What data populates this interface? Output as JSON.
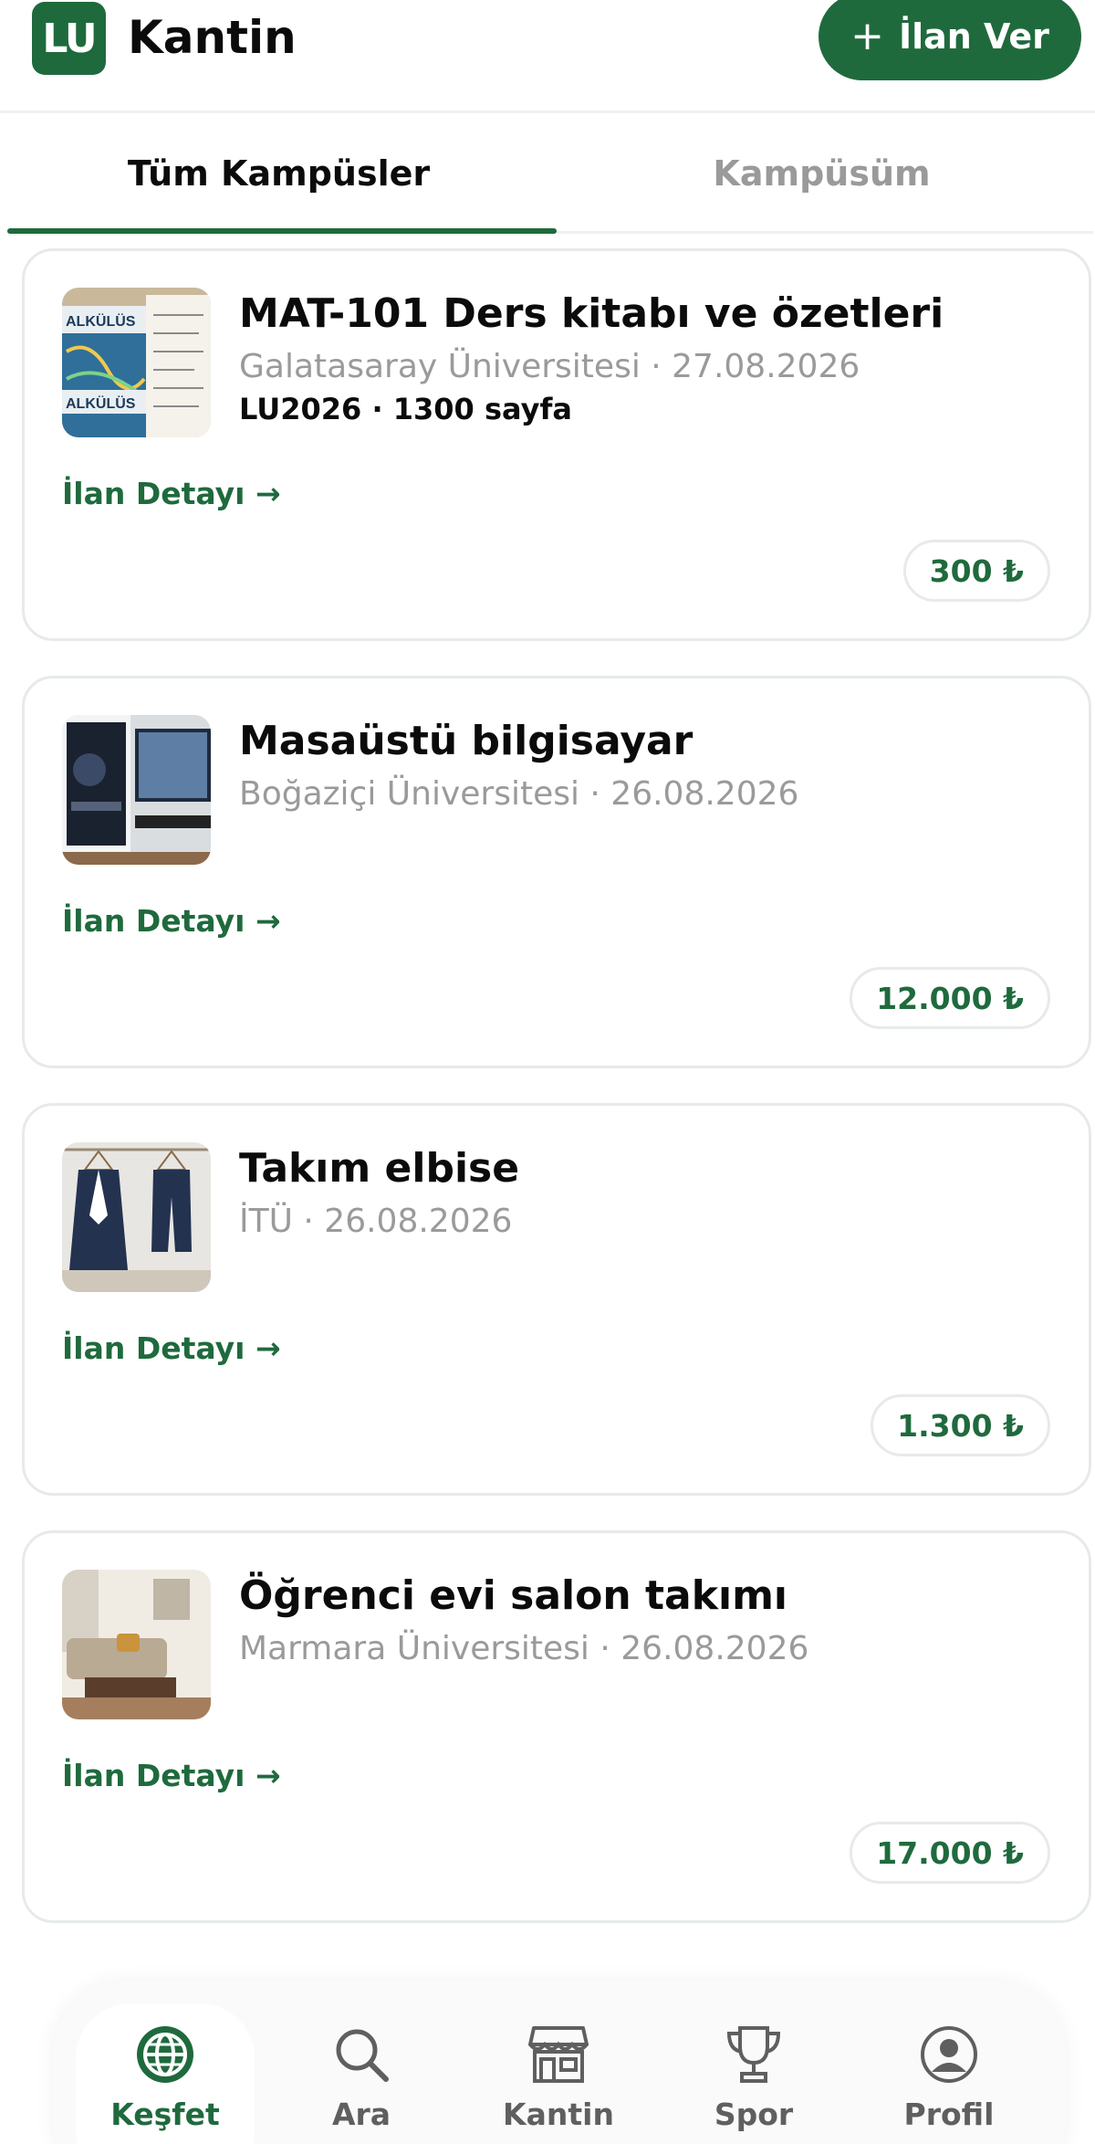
{
  "header": {
    "logo_text": "LU",
    "title": "Kantin",
    "post_button_label": "İlan Ver"
  },
  "tabs": [
    {
      "label": "Tüm Kampüsler",
      "active": true
    },
    {
      "label": "Kampüsüm",
      "active": false
    }
  ],
  "listings": [
    {
      "title": "MAT-101 Ders kitabı ve özetleri",
      "meta": "Galatasaray Üniversitesi · 27.08.2026",
      "extra": "LU2026 · 1300 sayfa",
      "detail_label": "İlan Detayı →",
      "price": "300 ₺",
      "thumb_icon": "book-photo"
    },
    {
      "title": "Masaüstü bilgisayar",
      "meta": "Boğaziçi Üniversitesi · 26.08.2026",
      "extra": "",
      "detail_label": "İlan Detayı →",
      "price": "12.000 ₺",
      "thumb_icon": "computer-photo"
    },
    {
      "title": "Takım elbise",
      "meta": "İTÜ · 26.08.2026",
      "extra": "",
      "detail_label": "İlan Detayı →",
      "price": "1.300 ₺",
      "thumb_icon": "suit-photo"
    },
    {
      "title": "Öğrenci evi salon takımı",
      "meta": "Marmara Üniversitesi · 26.08.2026",
      "extra": "",
      "detail_label": "İlan Detayı →",
      "price": "17.000 ₺",
      "thumb_icon": "living-room-photo"
    }
  ],
  "bottom_nav": [
    {
      "label": "Keşfet",
      "icon": "globe-icon",
      "active": true
    },
    {
      "label": "Ara",
      "icon": "search-icon",
      "active": false
    },
    {
      "label": "Kantin",
      "icon": "store-icon",
      "active": false
    },
    {
      "label": "Spor",
      "icon": "trophy-icon",
      "active": false
    },
    {
      "label": "Profil",
      "icon": "profile-icon",
      "active": false
    }
  ],
  "colors": {
    "brand_green": "#1f6a3d",
    "muted_text": "#9a9a9a",
    "border": "#e6ebe8"
  }
}
